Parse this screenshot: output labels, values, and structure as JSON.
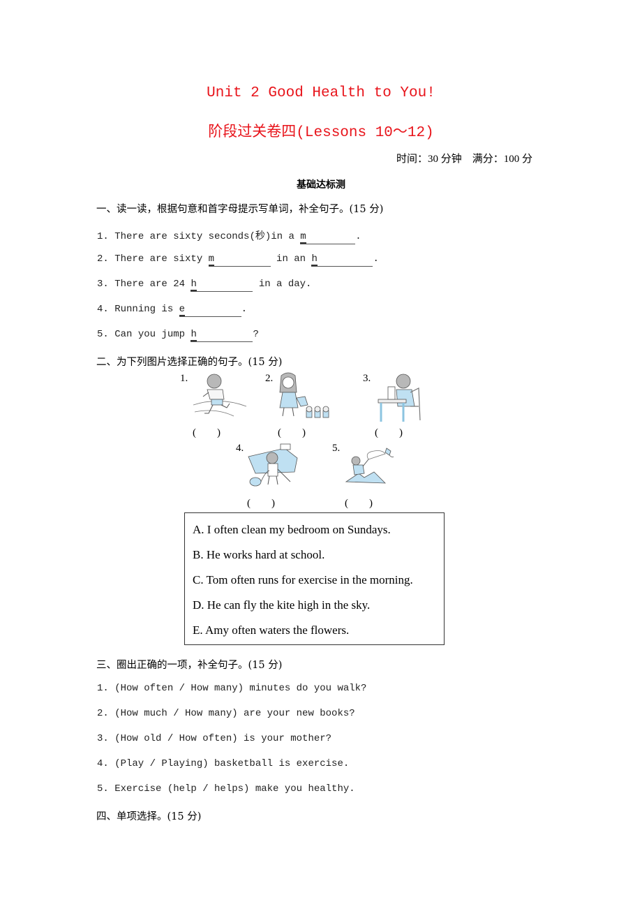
{
  "header": {
    "title": "Unit 2 Good Health to You!",
    "subtitle": "阶段过关卷四(Lessons 10～12)",
    "meta": "时间：30 分钟　满分：100 分",
    "subhead": "基础达标测"
  },
  "section1": {
    "heading": "一、读一读，根据句意和首字母提示写单词，补全句子。(15 分)",
    "items": [
      {
        "num": "1.",
        "parts": [
          "There are sixty seconds(秒)in a ",
          "m",
          "."
        ]
      },
      {
        "num": "2.",
        "parts": [
          "There are sixty ",
          "m",
          " in an ",
          "h",
          "."
        ]
      },
      {
        "num": "3.",
        "parts": [
          "There are 24 ",
          "h",
          " in a day."
        ]
      },
      {
        "num": "4.",
        "parts": [
          "Running is ",
          "e",
          "."
        ]
      },
      {
        "num": "5.",
        "parts": [
          "Can you jump ",
          "h",
          "?"
        ]
      }
    ]
  },
  "section2": {
    "heading": "二、为下列图片选择正确的句子。(15 分)",
    "pictures": [
      {
        "num": "1.",
        "image": "boy-running-illustration",
        "answer": "(　　)"
      },
      {
        "num": "2.",
        "image": "girl-watering-flowers-illustration",
        "answer": "(　　)"
      },
      {
        "num": "3.",
        "image": "boy-studying-at-desk-illustration",
        "answer": "(　　)"
      },
      {
        "num": "4.",
        "image": "boy-vacuuming-bedroom-illustration",
        "answer": "(　　)"
      },
      {
        "num": "5.",
        "image": "boy-flying-kite-illustration",
        "answer": "(　　)"
      }
    ],
    "choices": [
      "A. I often clean my bedroom on Sundays.",
      "B. He works hard at school.",
      "C. Tom often runs for exercise in the morning.",
      "D. He can fly the kite high in the sky.",
      "E. Amy often waters the flowers."
    ]
  },
  "section3": {
    "heading": "三、圈出正确的一项，补全句子。(15 分)",
    "items": [
      "1. (How often / How many) minutes do you walk?",
      "2. (How much / How many) are your new books?",
      "3. (How old / How often) is your mother?",
      "4. (Play / Playing) basketball is exercise.",
      "5. Exercise (help / helps) make you healthy."
    ]
  },
  "section4": {
    "heading": "四、单项选择。(15 分)"
  }
}
